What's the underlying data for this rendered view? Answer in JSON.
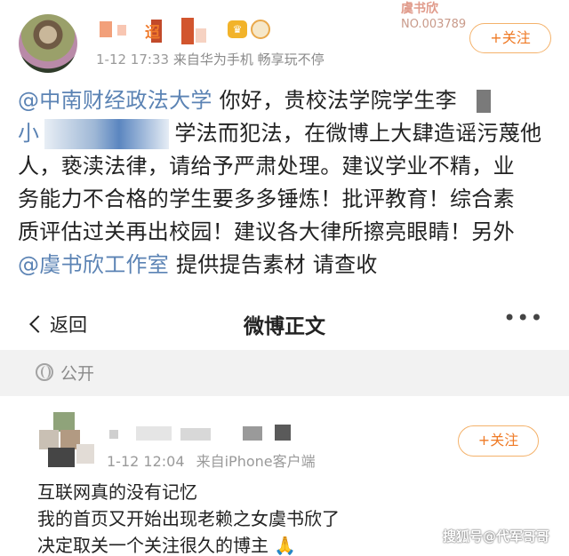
{
  "post1": {
    "author_name_visible": "迢",
    "time": "1-12 17:33",
    "source": "来自华为手机 畅享玩不停",
    "follow_label": "+关注",
    "badge_crown": "♛",
    "watermark_tag_line1": "虞书欣",
    "watermark_tag_line2": "NO.003789",
    "text": {
      "mention_school": "@中南财经政法大学",
      "line1_rest": " 你好，贵校法学院学生李",
      "line2_start": "小",
      "line2_rest": "学法而犯法，在微博上大肆造谣污蔑他",
      "line3": "人，亵渎法律，请给予严肃处理。建议学业不精，业",
      "line4": "务能力不合格的学生要多多锤炼！批评教育！综合素",
      "line5": "质评估过关再出校园！建议各大律所擦亮眼睛！另外",
      "mention_studio": "@虞书欣工作室",
      "line6_rest": " 提供提告素材 请查收"
    }
  },
  "nav": {
    "back_label": "返回",
    "title": "微博正文",
    "more": "•••"
  },
  "visibility": {
    "label": "公开"
  },
  "post2": {
    "time": "1-12 12:04",
    "source": "来自iPhone客户端",
    "follow_label": "+关注",
    "lines": [
      "互联网真的没有记忆",
      "我的首页又开始出现老赖之女虞书欣了",
      "决定取关一个关注很久的博主 🙏"
    ]
  },
  "watermark": "搜狐号@代军哥哥"
}
